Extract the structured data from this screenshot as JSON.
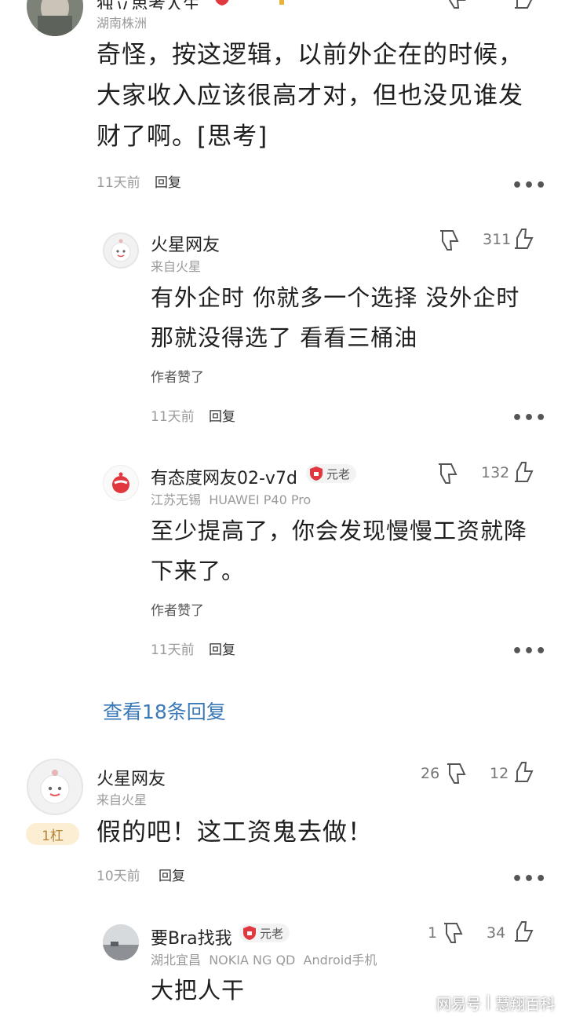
{
  "comment1": {
    "username_partial": "独立思考人生",
    "badge": "元老",
    "location": "湖南株洲",
    "text": "奇怪，按这逻辑，以前外企在的时候，大家收入应该很高才对，但也没见谁发财了啊。[思考]",
    "time": "11天前",
    "reply_label": "回复",
    "more": "•••"
  },
  "reply1": {
    "username": "火星网友",
    "location": "来自火星",
    "likes": "311",
    "text": "有外企时 你就多一个选择 没外企时 那就没得选了 看看三桶油",
    "author_liked": "作者赞了",
    "time": "11天前",
    "reply_label": "回复",
    "more": "•••"
  },
  "reply2": {
    "username": "有态度网友02-v7d",
    "badge": "元老",
    "location": "江苏无锡",
    "device": "HUAWEI P40 Pro",
    "likes": "132",
    "text": "至少提高了，你会发现慢慢工资就降下来了。",
    "author_liked": "作者赞了",
    "time": "11天前",
    "reply_label": "回复",
    "more": "•••"
  },
  "view_replies": "查看18条回复",
  "comment2": {
    "username": "火星网友",
    "location": "来自火星",
    "rank": "1杠",
    "dislikes": "26",
    "likes": "12",
    "text": "假的吧！这工资鬼去做！",
    "time": "10天前",
    "reply_label": "回复",
    "more": "•••"
  },
  "reply3": {
    "username": "要Bra找我",
    "badge": "元老",
    "location": "湖北宜昌",
    "device": "NOKIA NG QD",
    "platform": "Android手机",
    "dislikes": "1",
    "likes": "34",
    "text": "大把人干"
  },
  "watermark": {
    "site": "网易号",
    "separator": "|",
    "author": "慧翔百科"
  },
  "colors": {
    "link_blue": "#3a78b8",
    "badge_red": "#e0383e",
    "rank_bg": "#fbeed2"
  }
}
